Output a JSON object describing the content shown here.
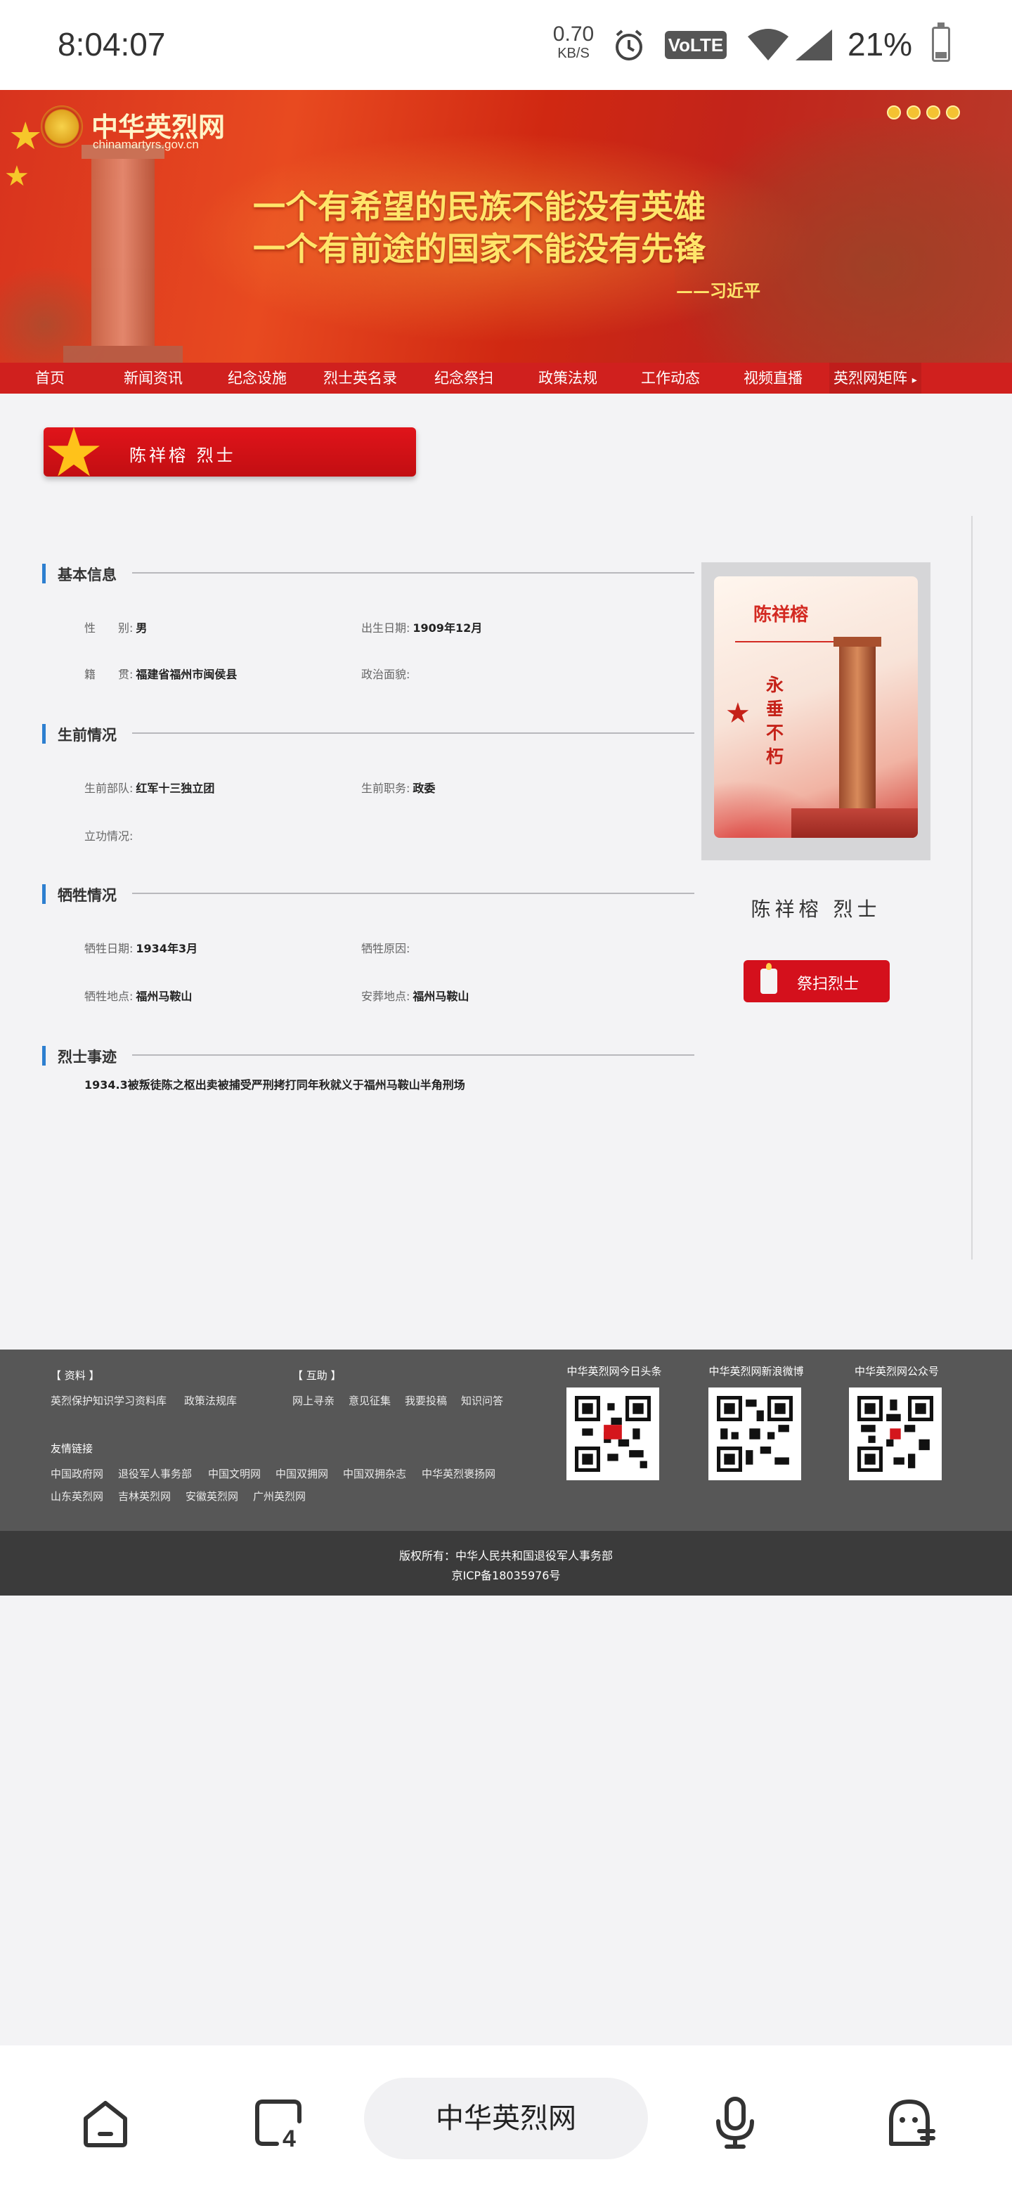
{
  "status_bar": {
    "time": "8:04:07",
    "net_speed": "0.70",
    "net_unit": "KB/S",
    "volte": "VoLTE",
    "battery": "21%"
  },
  "header": {
    "logo_title": "中华英烈网",
    "logo_url": "chinamartyrs.gov.cn",
    "slogan_line1": "一个有希望的民族不能没有英雄",
    "slogan_line2": "一个有前途的国家不能没有先锋",
    "slogan_author": "——习近平"
  },
  "nav": {
    "items": [
      "首页",
      "新闻资讯",
      "纪念设施",
      "烈士英名录",
      "纪念祭扫",
      "政策法规",
      "工作动态",
      "视频直播",
      "英烈网矩阵"
    ]
  },
  "martyr": {
    "title": "陈祥榕  烈士",
    "side_name": "陈祥榕  烈士",
    "poster_name": "陈祥榕",
    "poster_motto": "永垂不朽",
    "worship_button": "祭扫烈士"
  },
  "sections": {
    "basic": {
      "title": "基本信息",
      "gender_label": "性　　别:",
      "gender": "男",
      "birth_label": "出生日期:",
      "birth": "1909年12月",
      "native_label": "籍　　贯:",
      "native": "福建省福州市闽侯县",
      "political_label": "政治面貌:",
      "political": ""
    },
    "life": {
      "title": "生前情况",
      "unit_label": "生前部队:",
      "unit": "红军十三独立团",
      "post_label": "生前职务:",
      "post": "政委",
      "merit_label": "立功情况:",
      "merit": ""
    },
    "sacrifice": {
      "title": "牺牲情况",
      "date_label": "牺牲日期:",
      "date": "1934年3月",
      "reason_label": "牺牲原因:",
      "reason": "",
      "place_label": "牺牲地点:",
      "place": "福州马鞍山",
      "burial_label": "安葬地点:",
      "burial": "福州马鞍山"
    },
    "deeds": {
      "title": "烈士事迹",
      "text": "1934.3被叛徒陈之枢出卖被捕受严刑拷打同年秋就义于福州马鞍山半角刑场"
    }
  },
  "footer": {
    "resources_title": "【 资料 】",
    "resources": [
      "英烈保护知识学习资料库",
      "政策法规库"
    ],
    "interact_title": "【 互助 】",
    "interact": [
      "网上寻亲",
      "意见征集",
      "我要投稿",
      "知识问答"
    ],
    "friends_title": "友情链接",
    "friends_row1": [
      "中国政府网",
      "退役军人事务部",
      "中国文明网",
      "中国双拥网",
      "中国双拥杂志",
      "中华英烈褒扬网"
    ],
    "friends_row2": [
      "山东英烈网",
      "吉林英烈网",
      "安徽英烈网",
      "广州英烈网"
    ],
    "qr1": "中华英烈网今日头条",
    "qr2": "中华英烈网新浪微博",
    "qr3": "中华英烈网公众号",
    "copyright": "版权所有：中华人民共和国退役军人事务部",
    "icp": "京ICP备18035976号"
  },
  "browser": {
    "address": "中华英烈网",
    "icons": [
      "home-icon",
      "tabs-icon",
      "microphone-icon",
      "assistant-icon"
    ],
    "tab_count": "4"
  }
}
